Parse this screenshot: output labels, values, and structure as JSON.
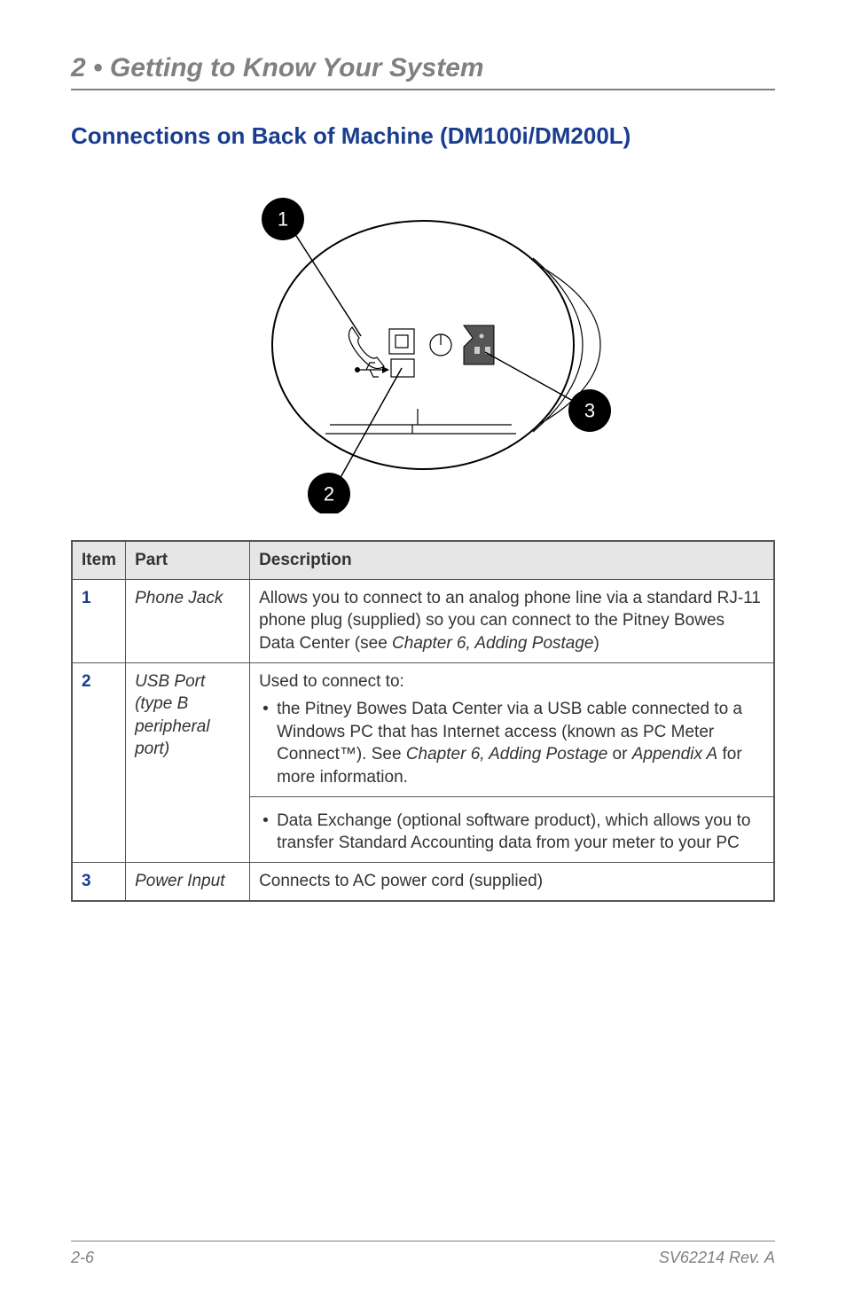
{
  "header": "2 • Getting to Know Your System",
  "title": "Connections on Back of Machine (DM100i/DM200L)",
  "callouts": [
    "1",
    "2",
    "3"
  ],
  "table": {
    "headers": {
      "item": "Item",
      "part": "Part",
      "desc": "Description"
    },
    "rows": [
      {
        "item": "1",
        "part": "Phone Jack",
        "desc_prefix": "Allows you to connect to an analog phone line via a standard RJ-11 phone plug (supplied) so you can connect to the Pitney Bowes Data Center (see ",
        "desc_italic": "Chapter 6, Adding Postage",
        "desc_suffix": ")"
      },
      {
        "item": "2",
        "part_line1": "USB Port",
        "part_line2": "(type B peripheral port)",
        "desc_head": "Used to connect to:",
        "bullet1_prefix": "the Pitney Bowes Data Center via a USB cable connected to a Windows PC that has Internet access (known as PC Meter Connect™). See ",
        "bullet1_italic1": "Chapter 6, Adding Postage",
        "bullet1_middle": " or ",
        "bullet1_italic2": "Appendix A",
        "bullet1_suffix": " for more information.",
        "bullet2": "Data Exchange (optional software product), which allows you to transfer Standard Accounting data from your meter to your PC"
      },
      {
        "item": "3",
        "part": "Power Input",
        "desc": "Connects to AC power cord (supplied)"
      }
    ]
  },
  "footer": {
    "page": "2-6",
    "doc": "SV62214 Rev. A"
  }
}
